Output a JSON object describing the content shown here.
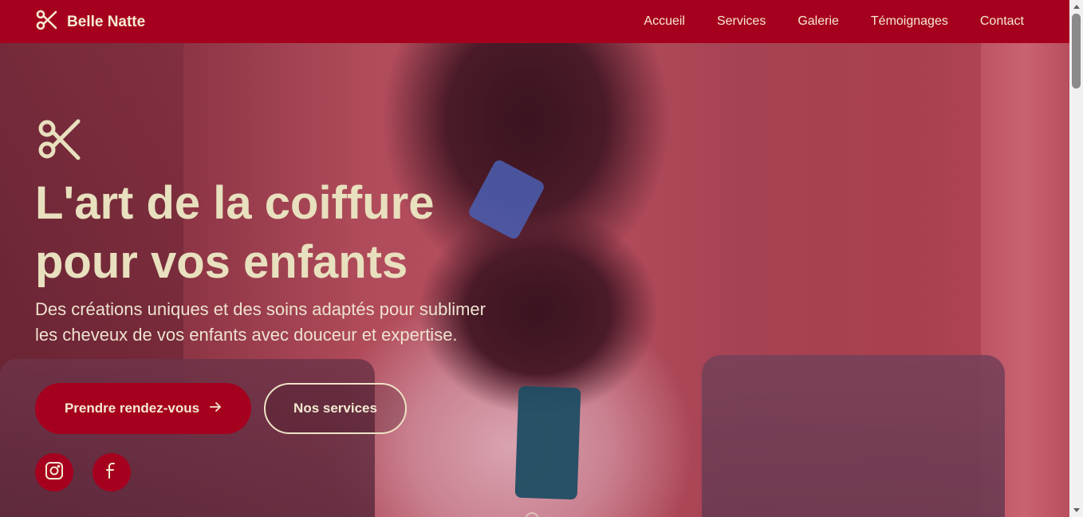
{
  "brand": {
    "name": "Belle Natte",
    "icon": "scissors-icon"
  },
  "nav": {
    "items": [
      "Accueil",
      "Services",
      "Galerie",
      "Témoignages",
      "Contact"
    ]
  },
  "hero": {
    "icon": "scissors-icon",
    "title_line1": "L'art de la coiffure",
    "title_line2": "pour vos enfants",
    "subtitle": "Des créations uniques et des soins adaptés pour sublimer les cheveux de vos enfants avec douceur et expertise.",
    "primary_button": "Prendre rendez-vous",
    "primary_button_icon": "arrow-right-icon",
    "secondary_button": "Nos services"
  },
  "social": {
    "icons": [
      "instagram-icon",
      "facebook-icon"
    ]
  },
  "colors": {
    "brand": "#a6001f",
    "text_light": "#f4ead2",
    "title": "#e8e0be"
  }
}
